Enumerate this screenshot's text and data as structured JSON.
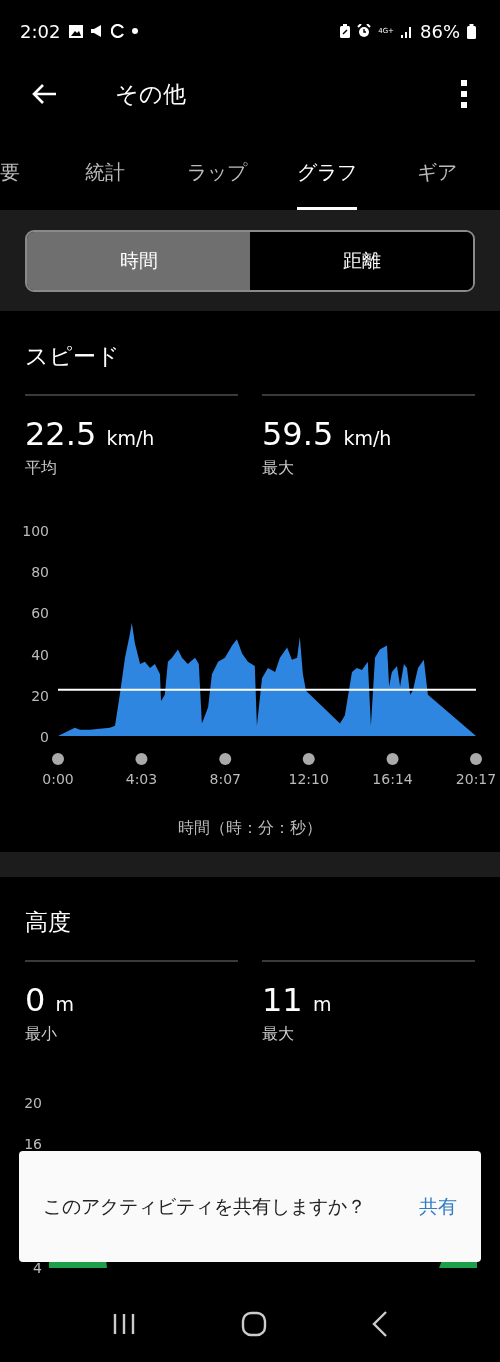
{
  "status_bar": {
    "time": "2:02",
    "network_label": "4G+",
    "battery": "86%"
  },
  "app_bar": {
    "title": "その他"
  },
  "tabs": [
    {
      "label": "要",
      "selected": false
    },
    {
      "label": "統計",
      "selected": false
    },
    {
      "label": "ラップ",
      "selected": false
    },
    {
      "label": "グラフ",
      "selected": true
    },
    {
      "label": "ギア",
      "selected": false
    }
  ],
  "segments": [
    {
      "label": "時間",
      "selected": true
    },
    {
      "label": "距離",
      "selected": false
    }
  ],
  "speed": {
    "title": "スピード",
    "stats": [
      {
        "value": "22.5",
        "unit": "km/h",
        "label": "平均"
      },
      {
        "value": "59.5",
        "unit": "km/h",
        "label": "最大"
      }
    ],
    "chart_data": {
      "type": "area",
      "xlabel": "時間（時：分：秒）",
      "xlim": [
        0,
        1217
      ],
      "ylim": [
        0,
        100
      ],
      "yticks": [
        0,
        20,
        40,
        60,
        80,
        100
      ],
      "xticks": [
        {
          "value": 0,
          "label": "0:00"
        },
        {
          "value": 243,
          "label": "4:03"
        },
        {
          "value": 487,
          "label": "8:07"
        },
        {
          "value": 730,
          "label": "12:10"
        },
        {
          "value": 974,
          "label": "16:14"
        },
        {
          "value": 1217,
          "label": "20:17"
        }
      ],
      "x": [
        0,
        49,
        64,
        93,
        151,
        166,
        180,
        195,
        210,
        215,
        224,
        239,
        253,
        268,
        282,
        291,
        297,
        300,
        311,
        320,
        332,
        349,
        361,
        378,
        399,
        410,
        419,
        437,
        448,
        466,
        486,
        507,
        521,
        536,
        553,
        573,
        579,
        594,
        611,
        632,
        646,
        667,
        681,
        696,
        704,
        713,
        722,
        821,
        835,
        856,
        870,
        885,
        902,
        911,
        923,
        937,
        958,
        964,
        972,
        987,
        996,
        1007,
        1016,
        1025,
        1033,
        1048,
        1065,
        1077,
        1217
      ],
      "series": [
        {
          "color": "#2f86e0",
          "values": [
            0,
            4,
            3,
            3,
            4,
            5,
            20,
            38,
            50,
            55,
            45,
            35,
            36,
            33,
            35,
            32,
            30,
            17,
            20,
            36,
            38,
            42,
            38,
            35,
            38,
            35,
            6,
            14,
            30,
            36,
            38,
            44,
            47,
            40,
            36,
            34,
            5,
            28,
            33,
            31,
            38,
            43,
            37,
            38,
            48,
            30,
            22,
            6,
            10,
            31,
            33,
            32,
            36,
            5,
            38,
            42,
            44,
            24,
            31,
            34,
            24,
            35,
            33,
            20,
            22,
            33,
            37,
            20,
            0
          ]
        }
      ]
    }
  },
  "altitude": {
    "title": "高度",
    "stats": [
      {
        "value": "0",
        "unit": "m",
        "label": "最小"
      },
      {
        "value": "11",
        "unit": "m",
        "label": "最大"
      }
    ],
    "y_ticks": [
      "20",
      "16",
      "4"
    ]
  },
  "toast": {
    "message": "このアクティビティを共有しますか？",
    "action": "共有"
  }
}
